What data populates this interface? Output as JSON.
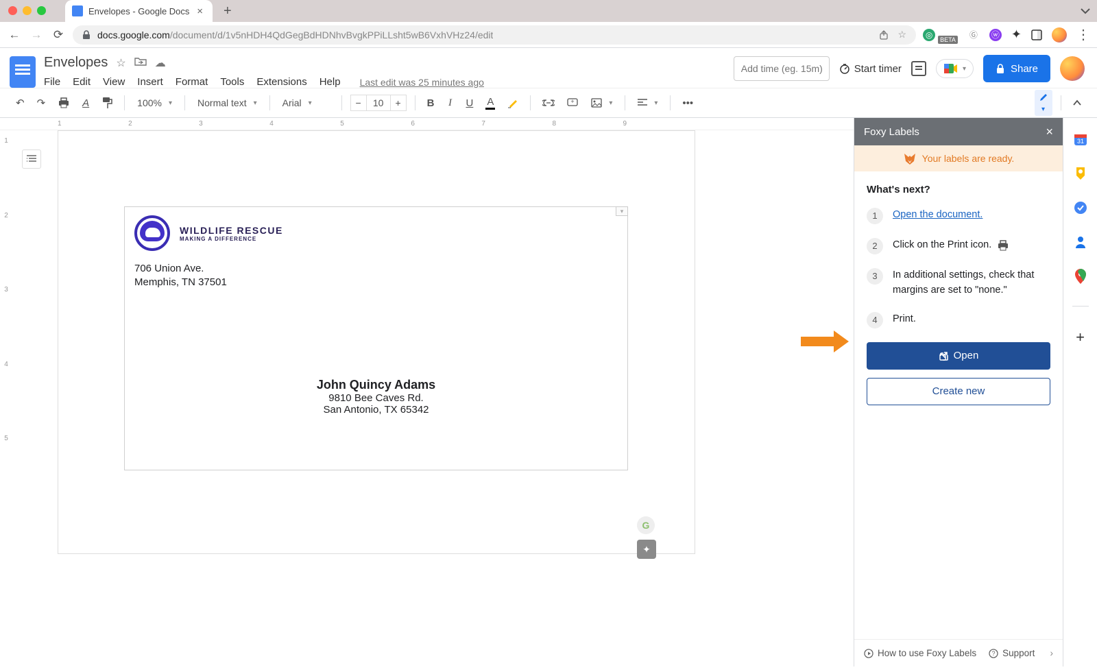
{
  "browser": {
    "tab_title": "Envelopes - Google Docs",
    "url_host": "docs.google.com",
    "url_path": "/document/d/1v5nHDH4QdGegBdHDNhvBvgkPPiLLsht5wB6VxhVHz24/edit"
  },
  "docs": {
    "title": "Envelopes",
    "menus": [
      "File",
      "Edit",
      "View",
      "Insert",
      "Format",
      "Tools",
      "Extensions",
      "Help"
    ],
    "last_edit": "Last edit was 25 minutes ago",
    "add_time_placeholder": "Add time (eg. 15m)",
    "start_timer": "Start timer",
    "share": "Share",
    "toolbar": {
      "zoom": "100%",
      "style": "Normal text",
      "font": "Arial",
      "font_size": "10"
    }
  },
  "envelope": {
    "brand": "WILDLIFE RESCUE",
    "brand_sub": "MAKING A DIFFERENCE",
    "return_line1": "706 Union Ave.",
    "return_line2": "Memphis, TN 37501",
    "to_name": "John Quincy Adams",
    "to_line1": "9810 Bee Caves Rd.",
    "to_line2": "San Antonio, TX 65342"
  },
  "addon": {
    "title": "Foxy Labels",
    "banner": "Your labels are ready.",
    "whats_next": "What's next?",
    "steps": [
      {
        "num": "1",
        "html": "link",
        "text": "Open the document."
      },
      {
        "num": "2",
        "text": "Click on the Print icon."
      },
      {
        "num": "3",
        "text": "In additional settings, check that margins are set to \"none.\""
      },
      {
        "num": "4",
        "text": "Print."
      }
    ],
    "open": "Open",
    "create_new": "Create new",
    "footer_how": "How to use Foxy Labels",
    "footer_support": "Support"
  }
}
